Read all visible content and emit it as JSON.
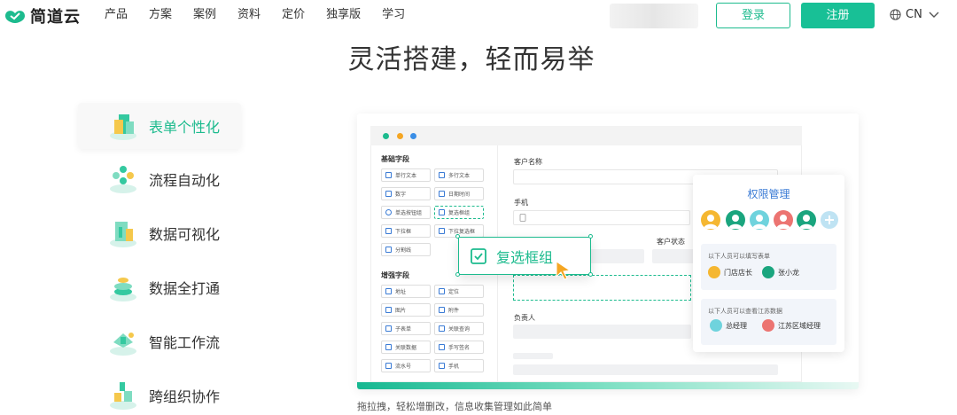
{
  "brand": {
    "name": "简道云",
    "color": "#1dbb8e"
  },
  "nav": {
    "items": [
      "产品",
      "方案",
      "案例",
      "资料",
      "定价",
      "独享版",
      "学习"
    ],
    "login": "登录",
    "register": "注册",
    "lang": "CN"
  },
  "headline": "灵活搭建，轻而易举",
  "features": [
    {
      "label": "表单个性化",
      "icon": "form-icon",
      "active": true
    },
    {
      "label": "流程自动化",
      "icon": "workflow-icon",
      "active": false
    },
    {
      "label": "数据可视化",
      "icon": "chart-icon",
      "active": false
    },
    {
      "label": "数据全打通",
      "icon": "database-icon",
      "active": false
    },
    {
      "label": "智能工作流",
      "icon": "smart-flow-icon",
      "active": false
    },
    {
      "label": "跨组织协作",
      "icon": "collab-icon",
      "active": false
    }
  ],
  "mockup": {
    "basic_title": "基础字段",
    "basic_fields": [
      "单行文本",
      "多行文本",
      "数字",
      "日期时间",
      "单选按钮组",
      "复选框组",
      "下拉框",
      "下拉复选框",
      "分割线"
    ],
    "enhanced_title": "增强字段",
    "enhanced_fields": [
      "地址",
      "定位",
      "图片",
      "附件",
      "子表单",
      "关联查询",
      "关联数据",
      "手写签名",
      "流水号",
      "手机"
    ],
    "form": {
      "customer_name": "客户名称",
      "phone": "手机",
      "customer_status": "客户状态",
      "owner": "负责人"
    },
    "drag_label": "复选框组",
    "permission": {
      "title": "权限管理",
      "fill_title": "以下人员可以填写表单",
      "fill_people": [
        "门店店长",
        "张小龙"
      ],
      "view_title": "以下人员可以查看江苏数据",
      "view_people": [
        "总经理",
        "江苏区域经理"
      ]
    }
  },
  "caption": "拖拉拽，轻松增删改，信息收集管理如此简单"
}
